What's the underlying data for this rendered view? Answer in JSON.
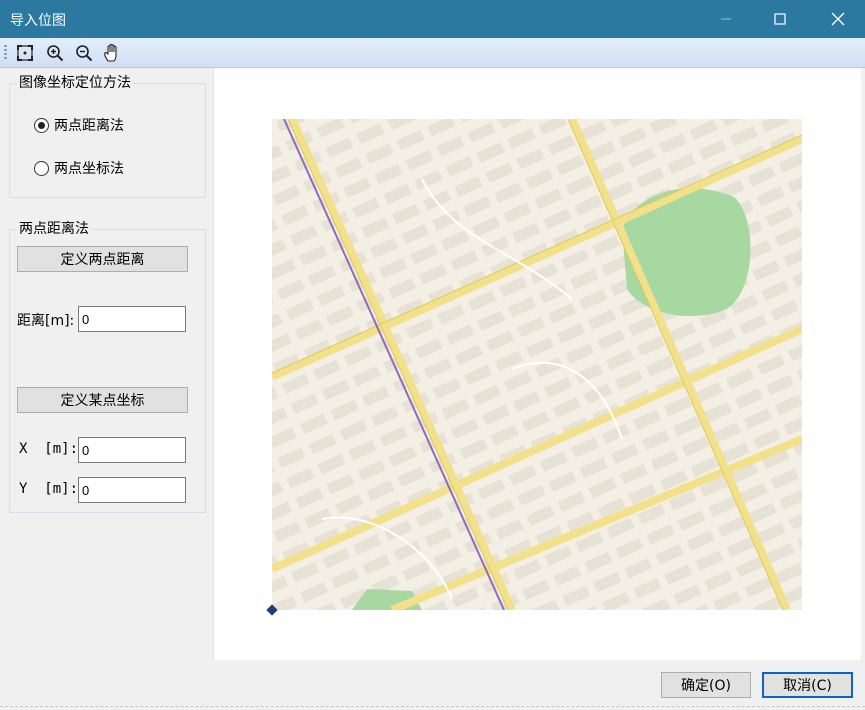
{
  "window": {
    "title": "导入位图"
  },
  "toolbar": {
    "icons": [
      "fit-extent-icon",
      "zoom-in-icon",
      "zoom-out-icon",
      "pan-hand-icon"
    ]
  },
  "method_group": {
    "legend": "图像坐标定位方法",
    "options": [
      {
        "label": "两点距离法",
        "selected": true
      },
      {
        "label": "两点坐标法",
        "selected": false
      }
    ]
  },
  "distance_group": {
    "legend": "两点距离法",
    "define_distance_button": "定义两点距离",
    "distance_label": "距离[m]:",
    "distance_value": "0",
    "define_point_button": "定义某点坐标",
    "x_label": "X  [m]:",
    "x_value": "0",
    "y_label": "Y  [m]:",
    "y_value": "0"
  },
  "footer": {
    "ok_label": "确定(O)",
    "cancel_label": "取消(C)"
  },
  "colors": {
    "titlebar": "#2b79a0",
    "map_background": "#f3efe5",
    "map_block": "#e7e2d6",
    "map_road_yellow": "#f2e18a",
    "map_metro_purple": "#8d6bbd",
    "map_park_green": "#a7d8a1"
  }
}
